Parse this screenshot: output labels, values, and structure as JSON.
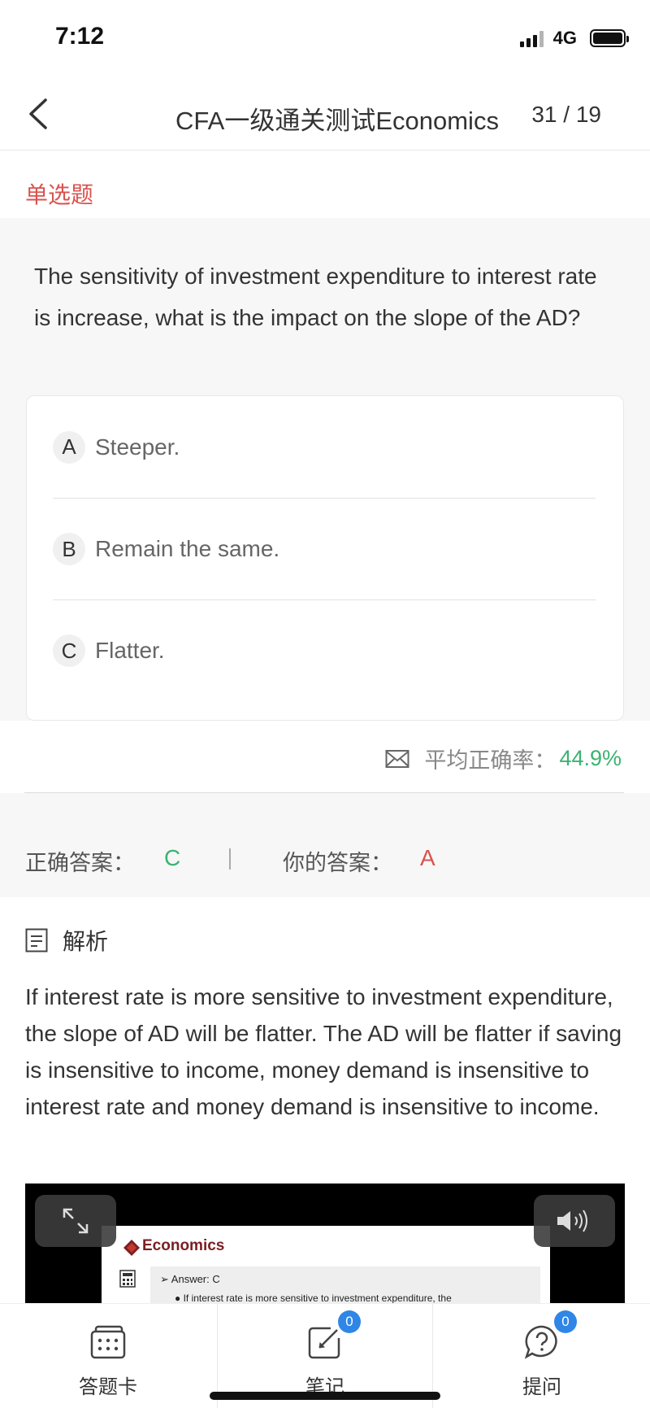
{
  "status_bar": {
    "time": "7:12",
    "network": "4G"
  },
  "nav": {
    "title": "CFA一级通关测试Economics",
    "counter": "31 / 19"
  },
  "question": {
    "type": "单选题",
    "text": "The sensitivity of investment expenditure to interest rate is increase, what is the impact on the slope of the AD?",
    "options": [
      {
        "letter": "A",
        "text": "Steeper."
      },
      {
        "letter": "B",
        "text": "Remain the same."
      },
      {
        "letter": "C",
        "text": "Flatter."
      }
    ]
  },
  "stats": {
    "accuracy_label": "平均正确率：",
    "accuracy_value": "44.9%"
  },
  "answers": {
    "correct_label": "正确答案：",
    "correct_value": "C",
    "your_label": "你的答案：",
    "your_value": "A"
  },
  "analysis": {
    "title": "解析",
    "text": "If interest rate is more sensitive to investment expenditure, the slope of AD will be flatter. The AD will be flatter if saving is insensitive to income, money demand is insensitive to interest rate and money demand is insensitive to income."
  },
  "video": {
    "slide_title": "Economics",
    "slide_answer": "➢  Answer: C",
    "slide_bullet": "●  If interest rate is more sensitive to investment expenditure, the"
  },
  "tabs": [
    {
      "label": "答题卡",
      "icon": "answer-card-icon"
    },
    {
      "label": "笔记",
      "icon": "note-edit-icon",
      "badge": "0"
    },
    {
      "label": "提问",
      "icon": "question-chat-icon",
      "badge": "0"
    }
  ],
  "colors": {
    "correct": "#3cb371",
    "wrong": "#d9534f",
    "badge": "#2f86e6"
  }
}
